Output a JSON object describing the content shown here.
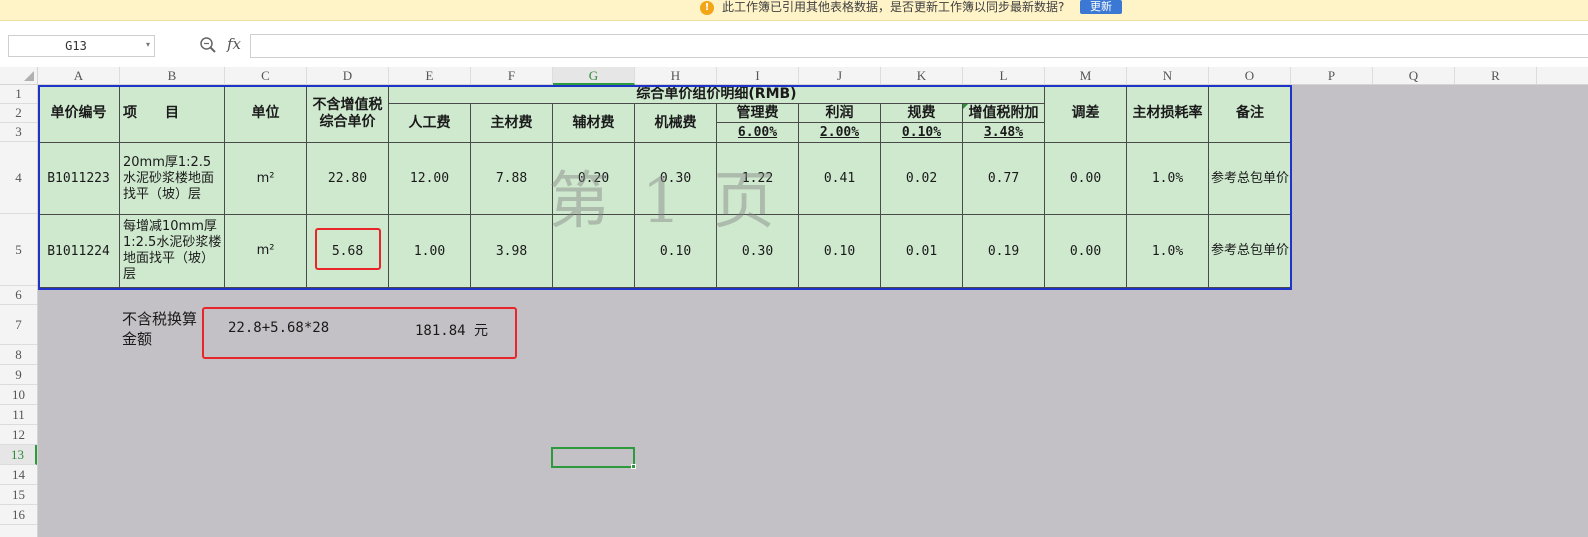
{
  "notification": {
    "icon": "warning-icon",
    "message": "此工作簿已引用其他表格数据，是否更新工作簿以同步最新数据?",
    "button": "更新"
  },
  "formula_bar": {
    "name_box": "G13",
    "fx": "fx",
    "formula": ""
  },
  "columns": [
    "A",
    "B",
    "C",
    "D",
    "E",
    "F",
    "G",
    "H",
    "I",
    "J",
    "K",
    "L",
    "M",
    "N",
    "O",
    "P",
    "Q",
    "R"
  ],
  "rows": [
    "1",
    "2",
    "3",
    "4",
    "5",
    "6",
    "7",
    "8",
    "9",
    "10",
    "11",
    "12",
    "13",
    "14",
    "15",
    "16"
  ],
  "selected_cell": {
    "column": "G",
    "row": "13"
  },
  "table": {
    "headers": {
      "code": "单价编号",
      "item": "项　　目",
      "unit": "单位",
      "price_excl_tax": "不含增值税综合单价",
      "breakdown": "综合单价组价明细(RMB)",
      "labor": "人工费",
      "main_material": "主材费",
      "aux_material": "辅材费",
      "machinery": "机械费",
      "management": "管理费",
      "management_rate": "6.00%",
      "profit": "利润",
      "profit_rate": "2.00%",
      "fees": "规费",
      "fees_rate": "0.10%",
      "vat_surcharge": "增值税附加",
      "vat_surcharge_rate": "3.48%",
      "adjustment": "调差",
      "loss_rate": "主材损耗率",
      "remark": "备注"
    },
    "rows": [
      {
        "code": "B1011223",
        "item": "20mm厚1:2.5水泥砂浆楼地面找平（坡）层",
        "unit": "m²",
        "price": "22.80",
        "labor": "12.00",
        "main_material": "7.88",
        "aux_material": "0.20",
        "machinery": "0.30",
        "management": "1.22",
        "profit": "0.41",
        "fees": "0.02",
        "vat_surcharge": "0.77",
        "adjustment": "0.00",
        "loss_rate": "1.0%",
        "remark": "参考总包单价"
      },
      {
        "code": "B1011224",
        "item": "每增减10mm厚1:2.5水泥砂浆楼地面找平（坡）层",
        "unit": "m²",
        "price": "5.68",
        "labor": "1.00",
        "main_material": "3.98",
        "aux_material": "",
        "machinery": "0.10",
        "management": "0.30",
        "profit": "0.10",
        "fees": "0.01",
        "vat_surcharge": "0.19",
        "adjustment": "0.00",
        "loss_rate": "1.0%",
        "remark": "参考总包单价"
      }
    ]
  },
  "watermark": "第 1 页",
  "calculation": {
    "label": "不含税换算金额",
    "formula": "22.8+5.68*28",
    "result": "181.84 元"
  }
}
